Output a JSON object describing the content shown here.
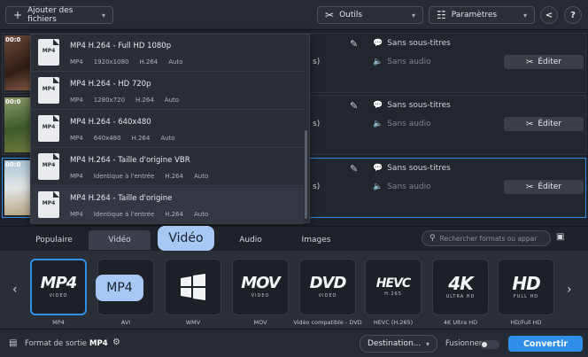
{
  "toolbar": {
    "add_files": "Ajouter des fichiers",
    "tools": "Outils",
    "settings": "Paramètres"
  },
  "rows": [
    {
      "duration": "00:0",
      "subtitles": "Sans sous-titres",
      "audio": "Sans audio",
      "edit": "Éditer",
      "audio_fragment": "s)"
    },
    {
      "duration": "00:0",
      "subtitles": "Sans sous-titres",
      "audio": "Sans audio",
      "edit": "Éditer",
      "audio_fragment": "s)"
    },
    {
      "duration": "00:0",
      "subtitles": "Sans sous-titres",
      "audio": "Sans audio",
      "edit": "Éditer",
      "audio_fragment": "s)"
    }
  ],
  "dropdown": {
    "items": [
      {
        "icon_label": "MP4",
        "title": "MP4 H.264 - Full HD 1080p",
        "meta": [
          "MP4",
          "1920x1080",
          "H.264",
          "Auto"
        ]
      },
      {
        "icon_label": "MP4",
        "title": "MP4 H.264 - HD 720p",
        "meta": [
          "MP4",
          "1280x720",
          "H.264",
          "Auto"
        ]
      },
      {
        "icon_label": "MP4",
        "title": "MP4 H.264 - 640x480",
        "meta": [
          "MP4",
          "640x480",
          "H.264",
          "Auto"
        ]
      },
      {
        "icon_label": "MP4",
        "title": "MP4 H.264 - Taille d'origine VBR",
        "meta": [
          "MP4",
          "Identique à l'entrée",
          "H.264",
          "Auto"
        ]
      },
      {
        "icon_label": "MP4",
        "title": "MP4 H.264 - Taille d'origine",
        "meta": [
          "MP4",
          "Identique à l'entrée",
          "H.264",
          "Auto"
        ]
      }
    ]
  },
  "tabs": {
    "popular": "Populaire",
    "video": "Vidéo",
    "audio": "Audio",
    "images": "Images"
  },
  "search": {
    "placeholder": "Rechercher formats ou appar"
  },
  "bubbles": {
    "video": "Vidéo",
    "mp4": "MP4"
  },
  "formats": [
    {
      "big": "MP4",
      "small": "VIDEO",
      "label": "MP4"
    },
    {
      "big": "",
      "small": "",
      "label": "AVI"
    },
    {
      "big": "",
      "small": "",
      "label": "WMV"
    },
    {
      "big": "MOV",
      "small": "VIDEO",
      "label": "MOV"
    },
    {
      "big": "DVD",
      "small": "VIDEO",
      "label": "Vidéo compatible - DVD"
    },
    {
      "big": "HEVC",
      "small": "H.265",
      "label": "HEVC (H.265)"
    },
    {
      "big": "4K",
      "small": "ULTRA HD",
      "label": "4K Ultra HD"
    },
    {
      "big": "HD",
      "small": "FULL HD",
      "label": "HD/Full HD"
    }
  ],
  "bottom": {
    "output_format_label": "Format de sortie :",
    "output_format_value": "MP4",
    "destination": "Destination...",
    "merge": "Fusionner :",
    "convert": "Convertir"
  }
}
